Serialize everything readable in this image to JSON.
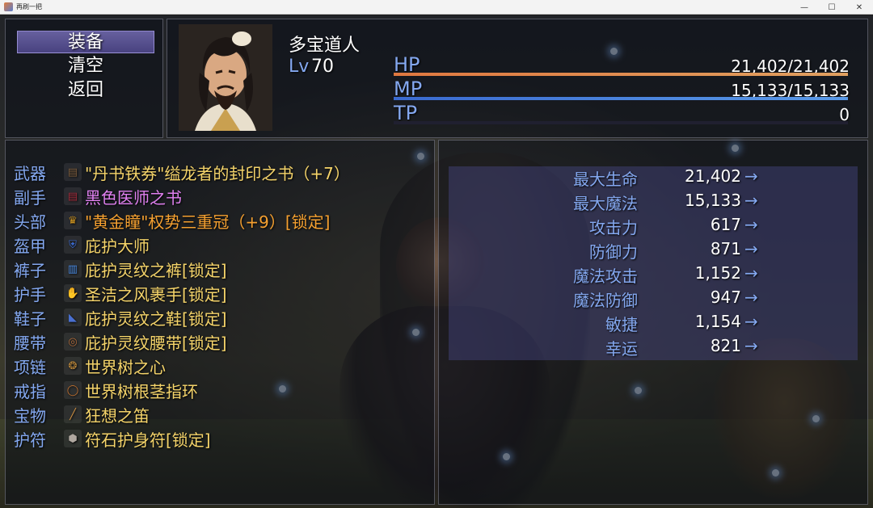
{
  "window": {
    "title": "再刷一把",
    "controls": {
      "minimize": "—",
      "maximize": "☐",
      "close": "✕"
    }
  },
  "commands": [
    {
      "label": "装备",
      "selected": true
    },
    {
      "label": "清空",
      "selected": false
    },
    {
      "label": "返回",
      "selected": false
    }
  ],
  "actor": {
    "name": "多宝道人",
    "level_label": "Lv",
    "level": "70",
    "hp": {
      "label": "HP",
      "value": "21,402/21,402",
      "fraction": 1.0,
      "color": "#e0a060"
    },
    "mp": {
      "label": "MP",
      "value": "15,133/15,133",
      "fraction": 1.0,
      "color": "#5a9ae8"
    },
    "tp": {
      "label": "TP",
      "value": "0",
      "fraction": 0.0,
      "color": "#5a9ae8"
    }
  },
  "equipment": [
    {
      "slot": "武器",
      "name": "\"丹书铁券\"缢龙者的封印之书（+7）",
      "color": "#f5d46a",
      "icon": "book-icon",
      "icon_color": "#7a5a3a"
    },
    {
      "slot": "副手",
      "name": "黑色医师之书",
      "color": "#e080f0",
      "icon": "red-book-icon",
      "icon_color": "#a02a3a"
    },
    {
      "slot": "头部",
      "name": "\"黄金瞳\"权势三重冠（+9）[锁定]",
      "color": "#f5a030",
      "icon": "crown-icon",
      "icon_color": "#c89020"
    },
    {
      "slot": "盔甲",
      "name": "庇护大师",
      "color": "#f5d46a",
      "icon": "armor-icon",
      "icon_color": "#3a6ad0"
    },
    {
      "slot": "裤子",
      "name": "庇护灵纹之裤[锁定]",
      "color": "#f5d46a",
      "icon": "pants-icon",
      "icon_color": "#4a8ae0"
    },
    {
      "slot": "护手",
      "name": "圣洁之风裹手[锁定]",
      "color": "#f5d46a",
      "icon": "glove-icon",
      "icon_color": "#c0b0a0"
    },
    {
      "slot": "鞋子",
      "name": "庇护灵纹之鞋[锁定]",
      "color": "#f5d46a",
      "icon": "shoes-icon",
      "icon_color": "#4a70d0"
    },
    {
      "slot": "腰带",
      "name": "庇护灵纹腰带[锁定]",
      "color": "#f5d46a",
      "icon": "belt-icon",
      "icon_color": "#b06a3a"
    },
    {
      "slot": "项链",
      "name": "世界树之心",
      "color": "#f5d46a",
      "icon": "necklace-icon",
      "icon_color": "#c08a3a"
    },
    {
      "slot": "戒指",
      "name": "世界树根茎指环",
      "color": "#f5d46a",
      "icon": "ring-icon",
      "icon_color": "#c07030"
    },
    {
      "slot": "宝物",
      "name": "狂想之笛",
      "color": "#f5d46a",
      "icon": "flute-icon",
      "icon_color": "#d09040"
    },
    {
      "slot": "护符",
      "name": "符石护身符[锁定]",
      "color": "#f5d46a",
      "icon": "rune-stone-icon",
      "icon_color": "#b0a8a0"
    }
  ],
  "params": [
    {
      "label": "最大生命",
      "value": "21,402",
      "arrow": "→"
    },
    {
      "label": "最大魔法",
      "value": "15,133",
      "arrow": "→"
    },
    {
      "label": "攻击力",
      "value": "617",
      "arrow": "→"
    },
    {
      "label": "防御力",
      "value": "871",
      "arrow": "→"
    },
    {
      "label": "魔法攻击",
      "value": "1,152",
      "arrow": "→"
    },
    {
      "label": "魔法防御",
      "value": "947",
      "arrow": "→"
    },
    {
      "label": "敏捷",
      "value": "1,154",
      "arrow": "→"
    },
    {
      "label": "幸运",
      "value": "821",
      "arrow": "→"
    }
  ]
}
